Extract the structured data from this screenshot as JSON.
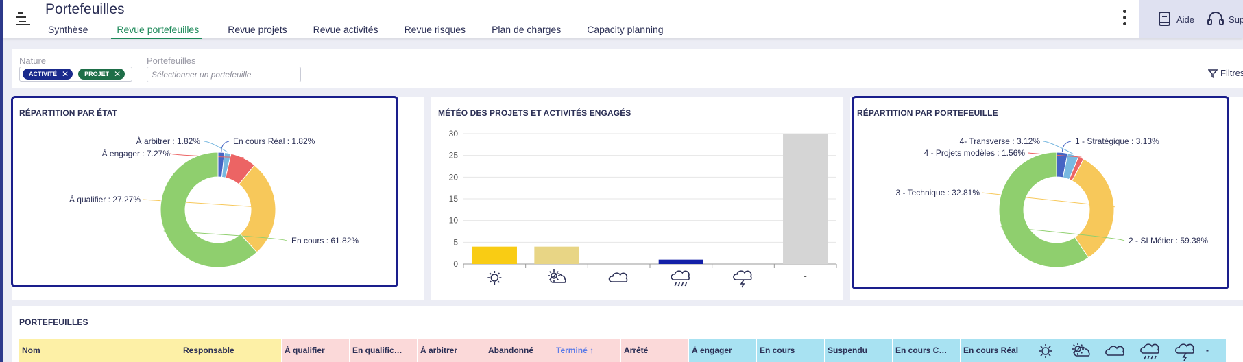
{
  "header": {
    "title": "Portefeuilles",
    "tabs": [
      "Synthèse",
      "Revue portefeuilles",
      "Revue projets",
      "Revue activités",
      "Revue risques",
      "Plan de charges",
      "Capacity planning"
    ],
    "active_tab": 1,
    "help_label": "Aide",
    "support_label": "Supp"
  },
  "filters": {
    "nature_label": "Nature",
    "tags": [
      {
        "label": "ACTIVITÉ",
        "color": "#1a2a8c"
      },
      {
        "label": "PROJET",
        "color": "#1e6e48"
      }
    ],
    "portfolio_label": "Portefeuilles",
    "portfolio_placeholder": "Sélectionner un portefeuille",
    "filters_button": "Filtres"
  },
  "chart_data": [
    {
      "type": "pie",
      "title": "RÉPARTITION PAR ÉTAT",
      "slices": [
        {
          "label": "En cours : 61.82%",
          "value": 61.82,
          "color": "#8fcf6e"
        },
        {
          "label": "À qualifier : 27.27%",
          "value": 27.27,
          "color": "#f7c85a"
        },
        {
          "label": "À engager : 7.27%",
          "value": 7.27,
          "color": "#ec6464"
        },
        {
          "label": "À arbitrer : 1.82%",
          "value": 1.82,
          "color": "#78b8e0"
        },
        {
          "label": "En cours Réal : 1.82%",
          "value": 1.82,
          "color": "#4665c4"
        }
      ]
    },
    {
      "type": "bar",
      "title": "MÉTÉO DES PROJETS ET ACTIVITÉS ENGAGÉS",
      "categories": [
        "sun",
        "sun-cloud",
        "cloud",
        "rain",
        "storm",
        "-"
      ],
      "values": [
        4,
        4,
        0,
        1,
        0,
        30
      ],
      "colors": [
        "#f9cc14",
        "#e8d585",
        "#cccccc",
        "#1320a8",
        "#cccccc",
        "#d5d5d5"
      ],
      "ylim": [
        0,
        30
      ],
      "yticks": [
        0,
        5,
        10,
        15,
        20,
        25,
        30
      ]
    },
    {
      "type": "pie",
      "title": "RÉPARTITION PAR PORTEFEUILLE",
      "slices": [
        {
          "label": "2 - SI Métier : 59.38%",
          "value": 59.38,
          "color": "#8fcf6e"
        },
        {
          "label": "3 - Technique : 32.81%",
          "value": 32.81,
          "color": "#f7c85a"
        },
        {
          "label": "4 - Projets modèles : 1.56%",
          "value": 1.56,
          "color": "#ec6464"
        },
        {
          "label": "4- Transverse : 3.12%",
          "value": 3.12,
          "color": "#78b8e0"
        },
        {
          "label": "1 - Stratégique : 3.13%",
          "value": 3.13,
          "color": "#4665c4"
        }
      ]
    }
  ],
  "table": {
    "title": "PORTEFEUILLES",
    "columns": [
      {
        "label": "Nom",
        "bg": "#fdf0a6"
      },
      {
        "label": "Responsable",
        "bg": "#fdf0a6"
      },
      {
        "label": "À qualifier",
        "bg": "#fbd9d9"
      },
      {
        "label": "En qualific…",
        "bg": "#fbd9d9"
      },
      {
        "label": "À arbitrer",
        "bg": "#fbd9d9"
      },
      {
        "label": "Abandonné",
        "bg": "#fbd9d9"
      },
      {
        "label": "Terminé ↑",
        "bg": "#fbd9d9",
        "color": "#5b7be8"
      },
      {
        "label": "Arrêté",
        "bg": "#fbd9d9"
      },
      {
        "label": "À engager",
        "bg": "#a8e2f2"
      },
      {
        "label": "En cours",
        "bg": "#a8e2f2"
      },
      {
        "label": "Suspendu",
        "bg": "#a8e2f2"
      },
      {
        "label": "En cours C…",
        "bg": "#a8e2f2"
      },
      {
        "label": "En cours Réal",
        "bg": "#a8e2f2"
      },
      {
        "icon": "sun-icon",
        "bg": "#a8e2f2"
      },
      {
        "icon": "sun-cloud-icon",
        "bg": "#a8e2f2"
      },
      {
        "icon": "cloud-icon",
        "bg": "#a8e2f2"
      },
      {
        "icon": "rain-icon",
        "bg": "#a8e2f2"
      },
      {
        "icon": "storm-icon",
        "bg": "#a8e2f2"
      },
      {
        "label": "-",
        "bg": "#a8e2f2"
      }
    ]
  }
}
